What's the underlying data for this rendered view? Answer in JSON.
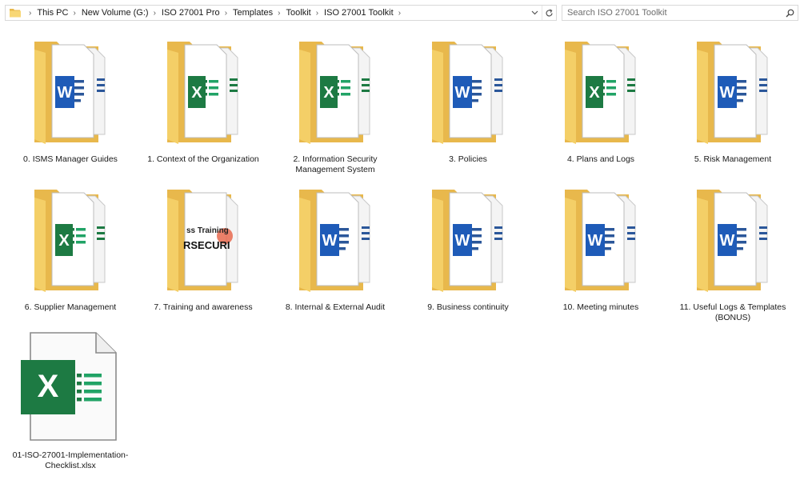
{
  "address_bar": {
    "breadcrumbs": [
      "This PC",
      "New Volume (G:)",
      "ISO 27001 Pro",
      "Templates",
      "Toolkit",
      "ISO 27001 Toolkit"
    ]
  },
  "search": {
    "placeholder": "Search ISO 27001 Toolkit"
  },
  "folders": [
    {
      "name": "0. ISMS Manager Guides",
      "preview": "word"
    },
    {
      "name": "1. Context of the Organization",
      "preview": "excel"
    },
    {
      "name": "2. Information Security Management System",
      "preview": "excel"
    },
    {
      "name": "3. Policies",
      "preview": "word"
    },
    {
      "name": "4. Plans and Logs",
      "preview": "excel"
    },
    {
      "name": "5. Risk Management",
      "preview": "word"
    },
    {
      "name": "6. Supplier Management",
      "preview": "excel"
    },
    {
      "name": "7. Training and awareness",
      "preview": "image",
      "preview_text_1": "ss Training",
      "preview_text_2": "RSECURI"
    },
    {
      "name": "8. Internal & External Audit",
      "preview": "word"
    },
    {
      "name": "9. Business continuity",
      "preview": "word"
    },
    {
      "name": "10. Meeting minutes",
      "preview": "word"
    },
    {
      "name": "11. Useful Logs & Templates (BONUS)",
      "preview": "word"
    }
  ],
  "files": [
    {
      "name": "01-ISO-27001-Implementation-Checklist.xlsx",
      "type": "excel",
      "icon_letter": "X"
    }
  ],
  "colors": {
    "folder_back": "#e8b84c",
    "folder_front": "#f8d775",
    "word": "#1e5bb8",
    "excel": "#1d7a43",
    "excel_light": "#21a366"
  }
}
